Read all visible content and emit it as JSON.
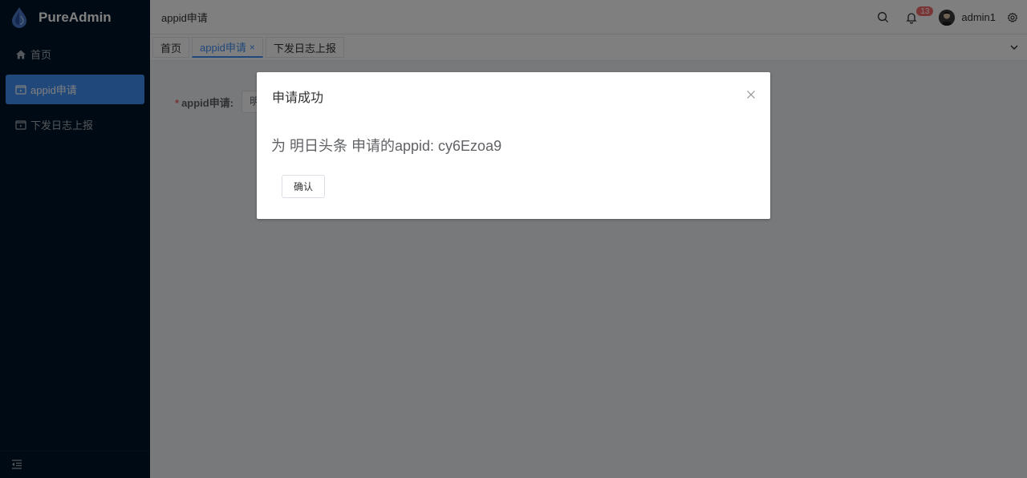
{
  "app": {
    "name": "PureAdmin"
  },
  "sidebar": {
    "items": [
      {
        "label": "首页",
        "icon": "home-icon"
      },
      {
        "label": "appid申请",
        "icon": "folder-icon",
        "active": true
      },
      {
        "label": "下发日志上报",
        "icon": "folder-icon"
      }
    ],
    "collapse_icon": "menu-fold-icon"
  },
  "header": {
    "breadcrumb": "appid申请",
    "notification_count": "13",
    "username": "admin1",
    "icons": [
      "search-icon",
      "bell-icon",
      "gear-icon"
    ]
  },
  "tags": [
    {
      "label": "首页"
    },
    {
      "label": "appid申请",
      "active": true,
      "close": "×"
    },
    {
      "label": "下发日志上报"
    }
  ],
  "form": {
    "label": "appid申请:",
    "required_mark": "*",
    "select_value": "明"
  },
  "dialog": {
    "title": "申请成功",
    "message": "为 明日头条 申请的appid: cy6Ezoa9",
    "confirm_label": "确认"
  },
  "colors": {
    "sidebar_bg": "#001529",
    "accent": "#4091f7",
    "badge": "#f56c6c"
  }
}
